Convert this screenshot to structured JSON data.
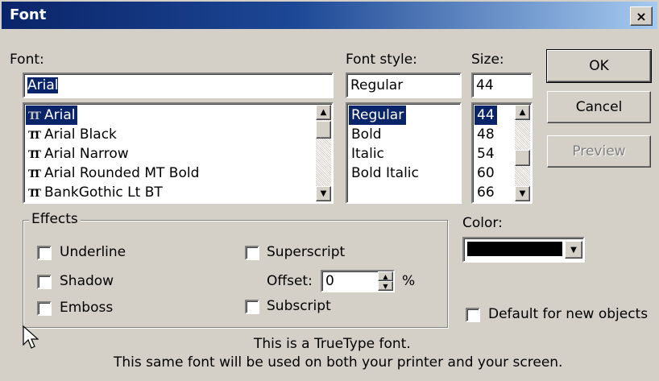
{
  "window": {
    "title": "Font"
  },
  "font": {
    "label": "Font:",
    "value": "Arial",
    "items": [
      "Arial",
      "Arial Black",
      "Arial Narrow",
      "Arial Rounded MT Bold",
      "BankGothic Lt BT"
    ],
    "selected_index": 0
  },
  "style": {
    "label": "Font style:",
    "value": "Regular",
    "items": [
      "Regular",
      "Bold",
      "Italic",
      "Bold Italic"
    ],
    "selected_index": 0
  },
  "size": {
    "label": "Size:",
    "value": "44",
    "items": [
      "44",
      "48",
      "54",
      "60",
      "66"
    ],
    "selected_index": 0
  },
  "buttons": {
    "ok": "OK",
    "cancel": "Cancel",
    "preview": "Preview"
  },
  "effects": {
    "title": "Effects",
    "underline": "Underline",
    "shadow": "Shadow",
    "emboss": "Emboss",
    "superscript": "Superscript",
    "offset_label": "Offset:",
    "offset_value": "0",
    "offset_unit": "%",
    "subscript": "Subscript"
  },
  "color": {
    "label": "Color:",
    "value_hex": "#000000"
  },
  "default_for_new": "Default for new objects",
  "info": {
    "line1": "This is a TrueType font.",
    "line2": "This same font will be used on both your printer and your screen."
  },
  "icons": {
    "truetype": "TT",
    "close": "×"
  }
}
